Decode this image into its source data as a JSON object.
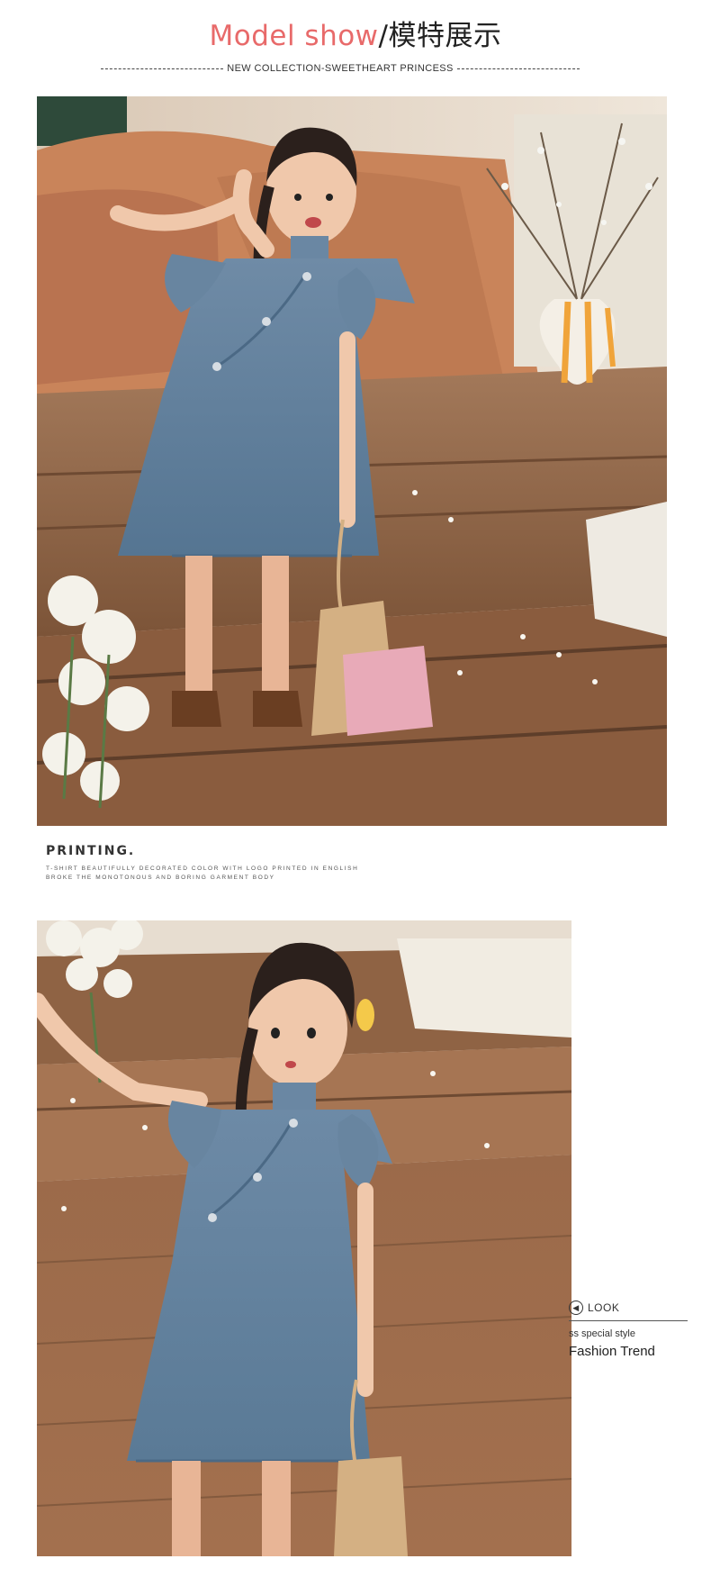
{
  "header": {
    "title_en": "Model show",
    "title_cn": "/模特展示",
    "subtitle": "NEW COLLECTION-SWEETHEART PRINCESS"
  },
  "photos": {
    "photo1": {
      "subject": "girl-denim-qipao-dress-waving"
    },
    "photo2": {
      "subject": "girl-denim-qipao-dress-holding-hand"
    }
  },
  "printing": {
    "heading": "PRINTING.",
    "line1": "T-SHIRT BEAUTIFULLY DECORATED COLOR WITH LOGO PRINTED IN ENGLISH",
    "line2": "BROKE THE MONOTONOUS AND BORING GARMENT BODY"
  },
  "side": {
    "look_label": "LOOK",
    "look_icon": "left-arrow-circle-icon",
    "small": "ss special style",
    "big": "Fashion Trend"
  },
  "colors": {
    "accent": "#e86a6a",
    "denim": "#5f7e9c",
    "wood": "#9a6a48",
    "sofa": "#c9845a"
  }
}
